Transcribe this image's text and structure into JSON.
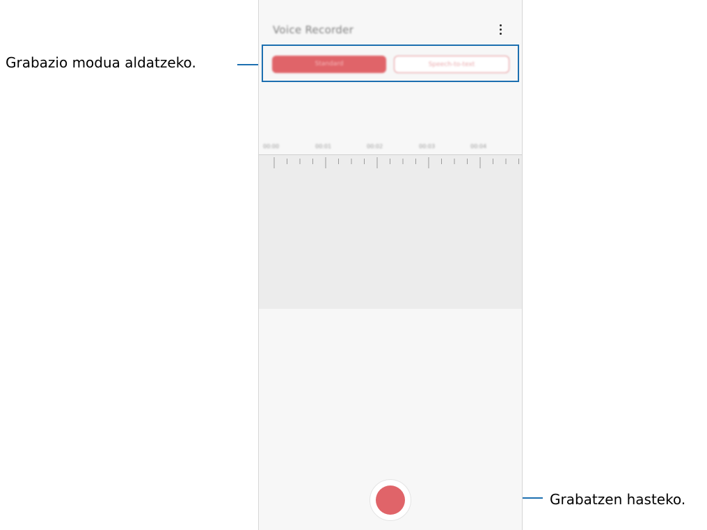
{
  "annotations": {
    "mode_switch": "Grabazio modua aldatzeko.",
    "start_recording": "Grabatzen hasteko."
  },
  "app": {
    "title": "Voice Recorder",
    "more_options_icon": "more-vertical-icon",
    "tabs": [
      {
        "label": "Standard",
        "selected": true
      },
      {
        "label": "Speech-to-text",
        "selected": false
      }
    ],
    "timeline_labels": [
      "00:00",
      "00:01",
      "00:02",
      "00:03",
      "00:04"
    ],
    "record_button_icon": "record-icon"
  },
  "colors": {
    "accent": "#e06469",
    "callout_line": "#1c6fb0",
    "screen_background": "#f7f7f7",
    "waveform_background": "#ececec"
  }
}
